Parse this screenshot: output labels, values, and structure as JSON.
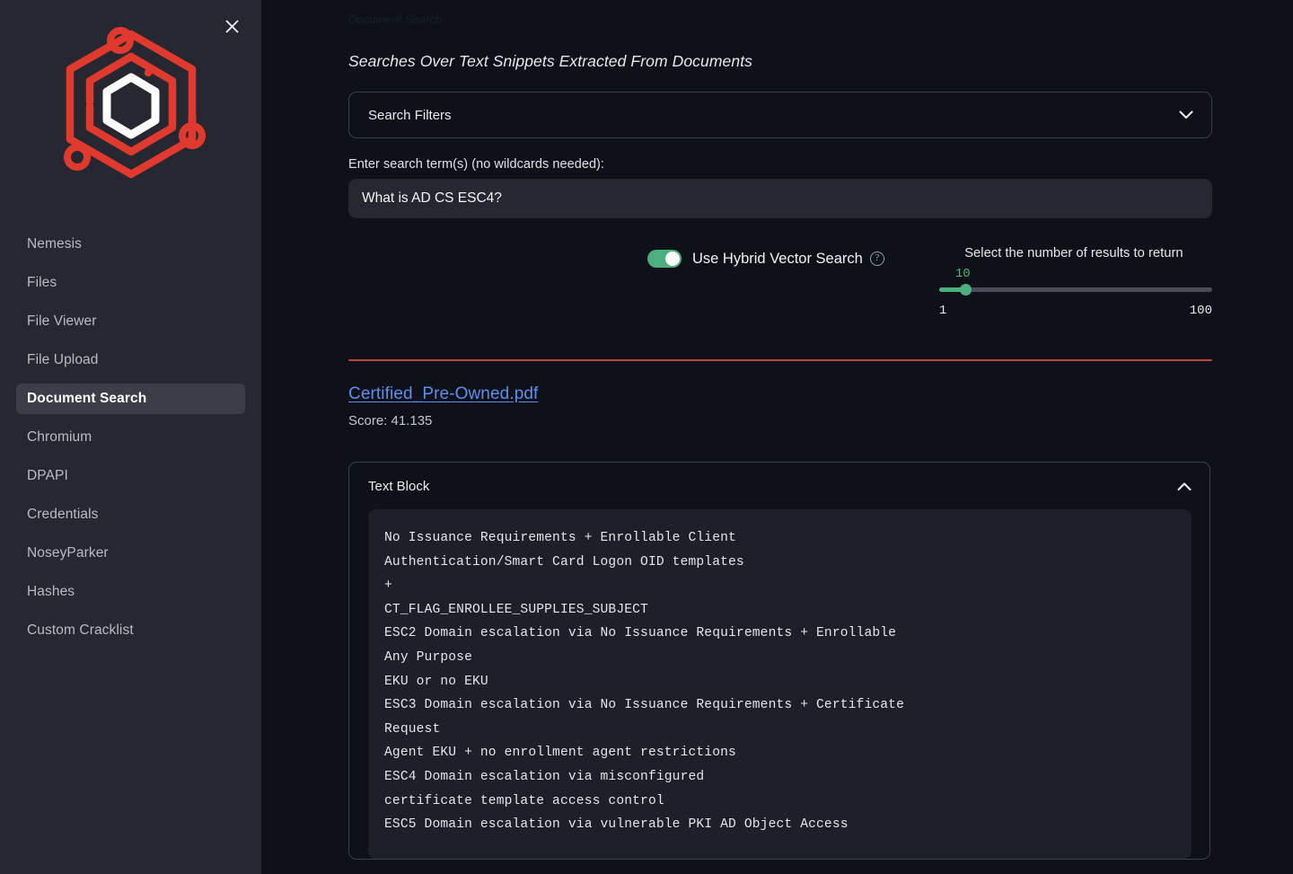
{
  "sidebar": {
    "close_label": "✕",
    "logo_name": "nemesis-hex-logo",
    "items": [
      {
        "label": "Nemesis",
        "active": false
      },
      {
        "label": "Files",
        "active": false
      },
      {
        "label": "File Viewer",
        "active": false
      },
      {
        "label": "File Upload",
        "active": false
      },
      {
        "label": "Document Search",
        "active": true
      },
      {
        "label": "Chromium",
        "active": false
      },
      {
        "label": "DPAPI",
        "active": false
      },
      {
        "label": "Credentials",
        "active": false
      },
      {
        "label": "NoseyParker",
        "active": false
      },
      {
        "label": "Hashes",
        "active": false
      },
      {
        "label": "Custom Cracklist",
        "active": false
      }
    ]
  },
  "main": {
    "ghost_title": "Document Search",
    "subtitle": "Searches Over Text Snippets Extracted From Documents",
    "filters": {
      "label": "Search Filters",
      "chevron_icon": "chevron-down-icon",
      "expanded": false
    },
    "search": {
      "label": "Enter search term(s) (no wildcards needed):",
      "value": "What is AD CS ESC4?",
      "placeholder": ""
    },
    "hybrid_toggle": {
      "label": "Use Hybrid Vector Search",
      "enabled": true,
      "help_icon": "help-circle-icon",
      "help_glyph": "?",
      "on_color": "#4caf7d"
    },
    "results_slider": {
      "title": "Select the number of results to return",
      "value": "10",
      "min": "1",
      "max": "100",
      "accent_color": "#4caf7d"
    },
    "divider_color": "#c0453c"
  },
  "result": {
    "filename": "Certified_Pre-Owned.pdf",
    "score_text": "Score: 41.135",
    "link_color": "#5b8ff0"
  },
  "text_block": {
    "title": "Text Block",
    "collapse_icon": "chevron-up-icon",
    "content": "No Issuance Requirements + Enrollable Client\nAuthentication/Smart Card Logon OID templates\n+\nCT_FLAG_ENROLLEE_SUPPLIES_SUBJECT\nESC2 Domain escalation via No Issuance Requirements + Enrollable\nAny Purpose\nEKU or no EKU\nESC3 Domain escalation via No Issuance Requirements + Certificate\nRequest\nAgent EKU + no enrollment agent restrictions\nESC4 Domain escalation via misconfigured\ncertificate template access control\nESC5 Domain escalation via vulnerable PKI AD Object Access"
  }
}
